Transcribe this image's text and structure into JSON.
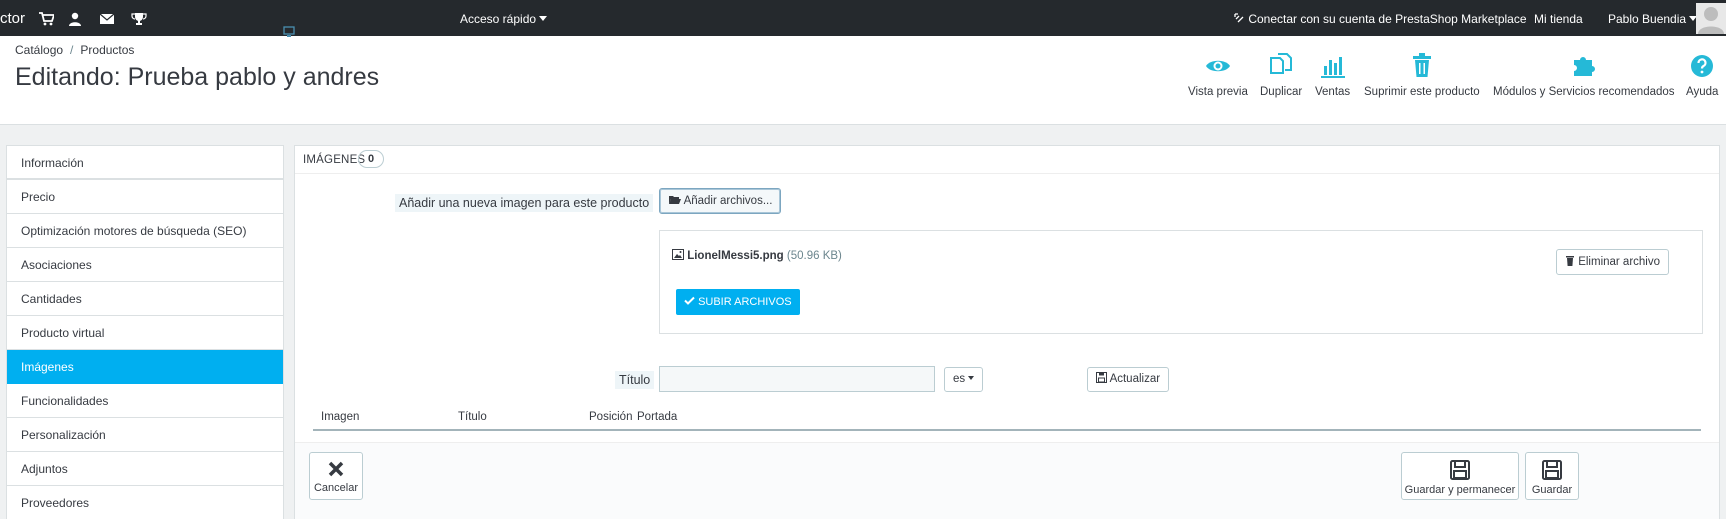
{
  "topbar": {
    "brand": "ctor",
    "quick_access": "Acceso rápido",
    "connect": "Conectar con su cuenta de PrestaShop Marketplace",
    "shop": "Mi tienda",
    "user": "Pablo Buendia"
  },
  "breadcrumb": {
    "level1": "Catálogo",
    "separator": "/",
    "level2": "Productos"
  },
  "page_title": "Editando: Prueba pablo y andres",
  "toolbar": {
    "preview": "Vista previa",
    "duplicate": "Duplicar",
    "sales": "Ventas",
    "delete": "Suprimir este producto",
    "modules": "Módulos y Servicios recomendados",
    "help": "Ayuda"
  },
  "sidebar": {
    "items": [
      {
        "label": "Información"
      },
      {
        "label": "Precio"
      },
      {
        "label": "Optimización motores de búsqueda (SEO)"
      },
      {
        "label": "Asociaciones"
      },
      {
        "label": "Cantidades"
      },
      {
        "label": "Producto virtual"
      },
      {
        "label": "Imágenes"
      },
      {
        "label": "Funcionalidades"
      },
      {
        "label": "Personalización"
      },
      {
        "label": "Adjuntos"
      },
      {
        "label": "Proveedores"
      }
    ],
    "active": "Imágenes"
  },
  "images_panel": {
    "heading": "Imágenes",
    "count": "0",
    "add_label": "Añadir una nueva imagen para este producto",
    "add_button": "Añadir archivos...",
    "file_name": "LionelMessi5.png",
    "file_size": "(50.96 KB)",
    "remove_button": "Eliminar archivo",
    "upload_button": "Subir archivos",
    "title_label": "Título",
    "title_value": "",
    "lang": "es",
    "update_button": "Actualizar",
    "columns": [
      "Imagen",
      "Título",
      "Posición",
      "Portada"
    ]
  },
  "footer": {
    "cancel": "Cancelar",
    "save_stay": "Guardar y permanecer",
    "save": "Guardar"
  },
  "colors": {
    "accent": "#00aff0",
    "topbar": "#25292d"
  }
}
